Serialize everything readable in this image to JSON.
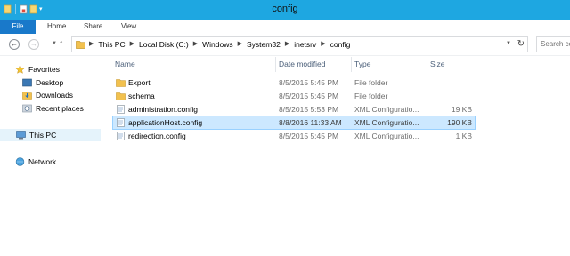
{
  "window": {
    "title": "config"
  },
  "ribbon": {
    "tabs": [
      "File",
      "Home",
      "Share",
      "View"
    ]
  },
  "address": {
    "crumbs": [
      "This PC",
      "Local Disk (C:)",
      "Windows",
      "System32",
      "inetsrv",
      "config"
    ],
    "search_placeholder": "Search config"
  },
  "nav": {
    "favorites": "Favorites",
    "desktop": "Desktop",
    "downloads": "Downloads",
    "recent": "Recent places",
    "thispc": "This PC",
    "network": "Network"
  },
  "columns": {
    "name": "Name",
    "date": "Date modified",
    "type": "Type",
    "size": "Size"
  },
  "files": [
    {
      "name": "Export",
      "date": "8/5/2015 5:45 PM",
      "type": "File folder",
      "size": "",
      "kind": "folder"
    },
    {
      "name": "schema",
      "date": "8/5/2015 5:45 PM",
      "type": "File folder",
      "size": "",
      "kind": "folder"
    },
    {
      "name": "administration.config",
      "date": "8/5/2015 5:53 PM",
      "type": "XML Configuratio...",
      "size": "19 KB",
      "kind": "config"
    },
    {
      "name": "applicationHost.config",
      "date": "8/8/2016 11:33 AM",
      "type": "XML Configuratio...",
      "size": "190 KB",
      "kind": "config",
      "selected": true
    },
    {
      "name": "redirection.config",
      "date": "8/5/2015 5:45 PM",
      "type": "XML Configuratio...",
      "size": "1 KB",
      "kind": "config"
    }
  ],
  "colors": {
    "titlebar": "#1ea7e1",
    "file_tab": "#1979ca",
    "selection": "#cce8ff"
  }
}
